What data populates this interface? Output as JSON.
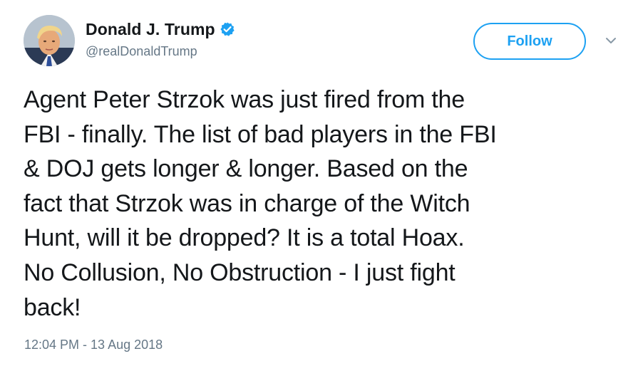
{
  "author": {
    "display_name": "Donald J. Trump",
    "handle": "@realDonaldTrump",
    "verified": true,
    "avatar_icon": "profile-photo"
  },
  "actions": {
    "follow_label": "Follow",
    "menu_icon": "chevron-down-icon"
  },
  "tweet": {
    "lines": [
      "Agent Peter Strzok was just fired from the",
      "FBI - finally. The list of bad players in the FBI",
      "& DOJ gets longer & longer. Based on the",
      "fact that Strzok was in charge of the Witch",
      "Hunt, will it be dropped? It is a total Hoax.",
      "No Collusion, No Obstruction - I just fight",
      "back!"
    ],
    "timestamp": "12:04 PM - 13 Aug 2018"
  },
  "colors": {
    "accent": "#1da1f2",
    "text": "#14171a",
    "secondary": "#657786"
  }
}
